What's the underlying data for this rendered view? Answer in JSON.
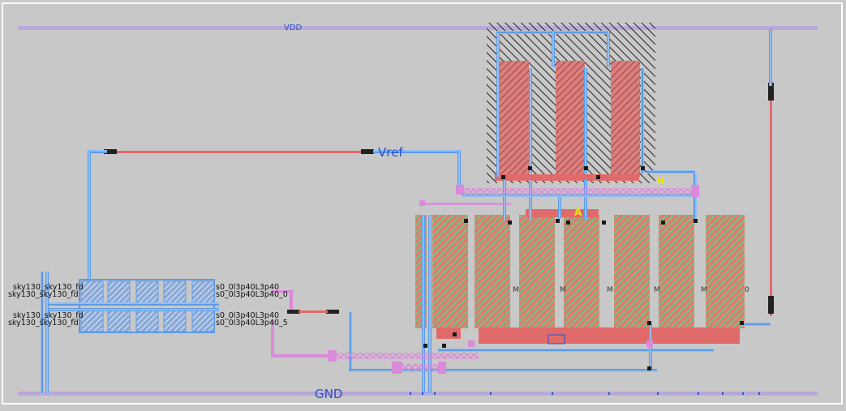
{
  "nets": {
    "vdd": "VDD",
    "gnd": "GND",
    "vref": "Vref"
  },
  "markers": {
    "h": "H",
    "a": "A"
  },
  "device_labels": {
    "m": "M",
    "zero": "0"
  },
  "cell_labels": {
    "row1_left_a": "sky130_sky130_fd",
    "row1_left_b": "sky130_sky130_fd",
    "row1_right_a": "s0_0l3p40L3p40",
    "row1_right_b": "s0_0l3p40L3p40_0",
    "row2_left_a": "sky130_sky130_fd",
    "row2_left_b": "sky130_sky130_fd",
    "row2_right_a": "s0_0l3p40L3p40",
    "row2_right_b": "s0_0l3p40L3p40_5"
  },
  "colors": {
    "background": "#c8c8c8",
    "rail": "#b9a9d9",
    "metal_blue": "#5b9be8",
    "poly_red": "#e06a6a",
    "diff_green": "#6ecb6e",
    "via_pink": "#d98ad9",
    "hatch": "#222222",
    "label_yellow": "#e8e800",
    "label_blue": "#2c4fc8"
  }
}
